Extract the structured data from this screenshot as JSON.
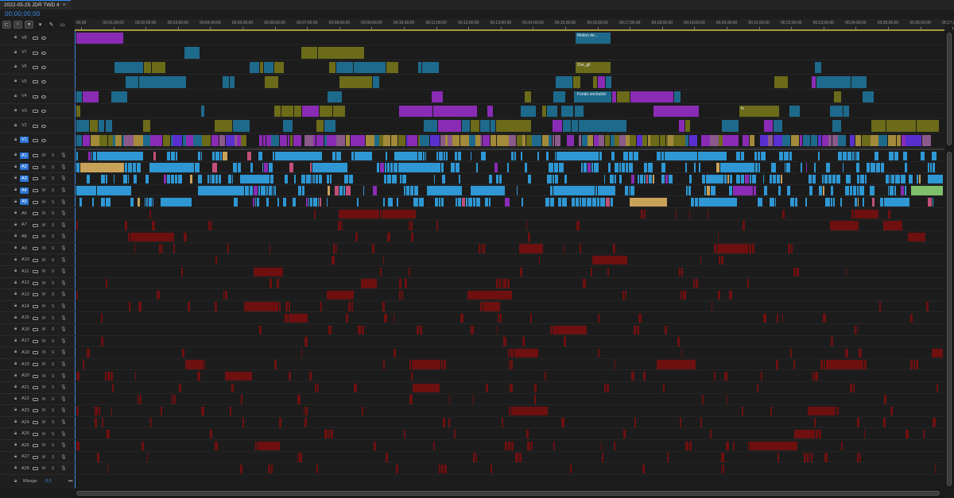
{
  "sequence_tab": {
    "title": "2022-05-25 JDR TWD 4",
    "menu_icon": "hamburger-icon"
  },
  "timecode": "00;00;00;00",
  "toolbar": {
    "tools": [
      "nest-icon",
      "snap-icon",
      "linked-selection-icon",
      "marker-icon",
      "wrench-icon",
      "captions-icon"
    ]
  },
  "ruler": {
    "labels": [
      "00;00",
      "00;01;00;00",
      "00;02;00;00",
      "00;03;00;00",
      "00;04;00;00",
      "00;05;00;00",
      "00;06;00;00",
      "00;07;00;00",
      "00;08;00;00",
      "00;09;00;00",
      "00;10;00;00",
      "00;11;00;00",
      "00;12;00;00",
      "00;13;00;00",
      "00;14;00;00",
      "00;15;00;00",
      "00;16;00;00",
      "00;17;00;00",
      "00;18;00;00",
      "00;19;00;00",
      "00;20;00;00",
      "00;21;00;00",
      "00;22;00;00",
      "00;23;00;00",
      "00;24;00;00",
      "00;25;00;00",
      "00;26;00;00",
      "00;27;00;00"
    ]
  },
  "video_tracks": [
    {
      "name": "V8"
    },
    {
      "name": "V7"
    },
    {
      "name": "V6"
    },
    {
      "name": "V5"
    },
    {
      "name": "V4"
    },
    {
      "name": "V3"
    },
    {
      "name": "V2"
    },
    {
      "name": "V1",
      "targeted": true
    }
  ],
  "audio_tracks": [
    {
      "name": "A1",
      "targeted": true
    },
    {
      "name": "A2",
      "targeted": true
    },
    {
      "name": "A3",
      "targeted": true
    },
    {
      "name": "A4",
      "targeted": true
    },
    {
      "name": "A5",
      "targeted": true
    },
    {
      "name": "A6"
    },
    {
      "name": "A7"
    },
    {
      "name": "A8"
    },
    {
      "name": "A9"
    },
    {
      "name": "A10"
    },
    {
      "name": "A11"
    },
    {
      "name": "A12"
    },
    {
      "name": "A13"
    },
    {
      "name": "A14"
    },
    {
      "name": "A15"
    },
    {
      "name": "A16"
    },
    {
      "name": "A17"
    },
    {
      "name": "A18"
    },
    {
      "name": "A19"
    },
    {
      "name": "A20"
    },
    {
      "name": "A21"
    },
    {
      "name": "A22"
    },
    {
      "name": "A23"
    },
    {
      "name": "A24"
    },
    {
      "name": "A25"
    },
    {
      "name": "A26"
    },
    {
      "name": "A27"
    },
    {
      "name": "A28"
    }
  ],
  "track_button_labels": {
    "mute": "M",
    "solo": "S"
  },
  "mixage": {
    "label": "Mixage",
    "value": "0,0"
  },
  "visible_clip_labels": {
    "v8_clip": "Motion de...",
    "v6_clip": "Zoe_gil",
    "v4_clip": "Fondu enchaîné",
    "v3_clip": "fx"
  },
  "colors": {
    "accent": "#2c76d8",
    "playhead": "#3b8ae6",
    "clip_teal": "#1e6a8c",
    "clip_violet": "#8a2bb5",
    "clip_olive": "#6b6b1a",
    "clip_purple": "#5a2fd0",
    "clip_audio_blue": "#2e97d4",
    "clip_audio_red": "#6e1010",
    "clip_audio_green": "#7fbf6a"
  }
}
